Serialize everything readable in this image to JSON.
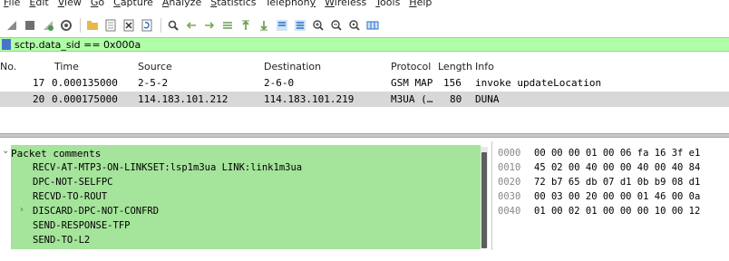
{
  "menu": [
    "File",
    "Edit",
    "View",
    "Go",
    "Capture",
    "Analyze",
    "Statistics",
    "Telephony",
    "Wireless",
    "Tools",
    "Help"
  ],
  "menu_underline": [
    "F",
    "E",
    "V",
    "G",
    "C",
    "A",
    "S",
    "y",
    "W",
    "T",
    "H"
  ],
  "toolbar_icons": [
    "shark-fin-icon",
    "stop-icon",
    "restart-icon",
    "options-icon",
    "open-icon",
    "save-icon",
    "close-file-icon",
    "reload-icon",
    "find-icon",
    "back-icon",
    "forward-icon",
    "goto-icon",
    "first-icon",
    "last-icon",
    "autoscroll-icon",
    "colorize-icon",
    "zoom-in-icon",
    "zoom-out-icon",
    "zoom-reset-icon",
    "resize-columns-icon"
  ],
  "filter": {
    "text": "sctp.data_sid == 0x000a",
    "color": "#b0ffa8"
  },
  "packet_list": {
    "headers": [
      "No.",
      "Time",
      "Source",
      "Destination",
      "Protocol",
      "Length",
      "Info"
    ],
    "rows": [
      {
        "no": "17",
        "time": "0.000135000",
        "source": "2-5-2",
        "destination": "2-6-0",
        "protocol": "GSM MAP",
        "length": "156",
        "info": "invoke updateLocation",
        "selected": false
      },
      {
        "no": "20",
        "time": "0.000175000",
        "source": "114.183.101.212",
        "destination": "114.183.101.219",
        "protocol": "M3UA (…",
        "length": "80",
        "info": "DUNA",
        "selected": true
      }
    ]
  },
  "details": {
    "head": "Packet comments",
    "lines": [
      "RECV-AT-MTP3-ON-LINKSET:lsp1m3ua LINK:link1m3ua",
      "DPC-NOT-SELFPC",
      "RECVD-TO-ROUT",
      "DISCARD-DPC-NOT-CONFRD",
      "SEND-RESPONSE-TFP",
      "SEND-TO-L2"
    ],
    "comment_color": "#a5e49b"
  },
  "hex": [
    {
      "offset": "0000",
      "bytes": "00 00 00 01 00 06 fa 16  3f e1"
    },
    {
      "offset": "0010",
      "bytes": "45 02 00 40 00 00 40 00  40 84"
    },
    {
      "offset": "0020",
      "bytes": "72 b7 65 db 07 d1 0b b9  08 d1"
    },
    {
      "offset": "0030",
      "bytes": "00 03 00 20 00 00 01 46  00 0a"
    },
    {
      "offset": "0040",
      "bytes": "01 00 02 01 00 00 00 10  00 12"
    }
  ]
}
